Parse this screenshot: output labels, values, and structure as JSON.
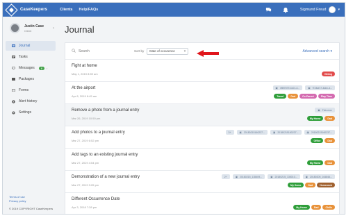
{
  "topbar": {
    "brand": "CaseKeepers",
    "nav": [
      "Clients",
      "Help/FAQs"
    ],
    "user_name": "Sigmund Freud"
  },
  "colors": {
    "brand_blue": "#3a6fbc",
    "tag_red": "#e24b4b",
    "tag_orange": "#e8923a",
    "tag_green": "#2f9e3a",
    "tag_pink": "#d46bb0",
    "tag_brown": "#a0612f",
    "arrow_red": "#e0161c"
  },
  "sidebar": {
    "profile_name": "Justin Case",
    "profile_role": "Client",
    "items": [
      {
        "label": "Journal",
        "icon": "journal-icon"
      },
      {
        "label": "Tasks",
        "icon": "tasks-icon"
      },
      {
        "label": "Messages",
        "icon": "messages-icon",
        "badge": "6"
      },
      {
        "label": "Packages",
        "icon": "packages-icon"
      },
      {
        "label": "Forms",
        "icon": "forms-icon"
      },
      {
        "label": "Alert history",
        "icon": "alert-icon"
      },
      {
        "label": "Settings",
        "icon": "gear-icon"
      }
    ],
    "footer_links": [
      "Terms of use",
      "Privacy policy"
    ],
    "copyright": "© 2019 COPYRIGHT CaseKeepers"
  },
  "main": {
    "title": "Journal",
    "search_placeholder": "Search",
    "sort_label": "Sort by",
    "sort_value": "Date of occurence",
    "advanced_search": "Advanced search"
  },
  "entries": [
    {
      "title": "Fight at home",
      "date": "May 1, 2019 8:59 am",
      "attachments": [],
      "tags": [
        {
          "label": "Hitting",
          "color": "#e24b4b"
        }
      ]
    },
    {
      "title": "At the airport",
      "date": "Apr 8, 2019 8:45 am",
      "attachments": [
        "4f6f7879-4c01-4...",
        "f724af17-4abc-4..."
      ],
      "tags": [
        {
          "label": "Travel",
          "color": "#2f9e3a"
        },
        {
          "label": "Dad",
          "color": "#e8923a"
        },
        {
          "label": "Co-Parent",
          "color": "#d46bb0"
        },
        {
          "label": "Play Time",
          "color": "#d46bb0"
        }
      ]
    },
    {
      "title": "Remove a photo from a journal entry",
      "date": "Mar 26, 2019 10:50 pm",
      "attachments": [
        "Fido.mov"
      ],
      "tags": [
        {
          "label": "My Home",
          "color": "#2f9e3a"
        },
        {
          "label": "Dad",
          "color": "#e8923a"
        }
      ]
    },
    {
      "title": "Add photos to a journal entry",
      "date": "Mar 27, 2019 6:52 pm",
      "count": "3+",
      "attachments": [
        "20180215160237...",
        "20180215160237...",
        "20180215160237..."
      ],
      "tags": [
        {
          "label": "Office",
          "color": "#2f9e3a"
        },
        {
          "label": "Dad",
          "color": "#e8923a"
        }
      ]
    },
    {
      "title": "Add tags to an existing journal entry",
      "date": "Mar 27, 2019 4:54 pm",
      "attachments": [],
      "tags": [
        {
          "label": "My Home",
          "color": "#2f9e3a"
        },
        {
          "label": "Dad",
          "color": "#e8923a"
        }
      ]
    },
    {
      "title": "Demonstration of a new journal entry",
      "date": "Mar 27, 2019 3:05 pm",
      "count": "2+",
      "attachments": [
        "20180215_135409...",
        "20180215_135010...",
        "20180205_164846..."
      ],
      "tags": [
        {
          "label": "My Home",
          "color": "#2f9e3a"
        },
        {
          "label": "Dad",
          "color": "#e8923a"
        },
        {
          "label": "Homework",
          "color": "#a0612f"
        }
      ]
    },
    {
      "title": "Different Occurrence Date",
      "date": "Apr 3, 2018 7:28 pm",
      "attachments": [],
      "tags": [
        {
          "label": "My Home",
          "color": "#2f9e3a"
        },
        {
          "label": "Dad",
          "color": "#e8923a"
        },
        {
          "label": "Chills",
          "color": "#e8923a"
        }
      ]
    }
  ]
}
